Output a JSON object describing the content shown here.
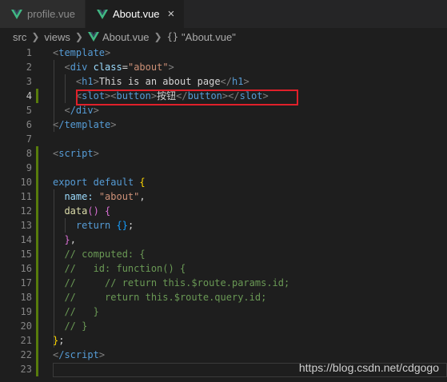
{
  "tabs": [
    {
      "label": "profile.vue",
      "active": false
    },
    {
      "label": "About.vue",
      "active": true,
      "close_glyph": "×"
    }
  ],
  "breadcrumb": {
    "segments": [
      "src",
      "views",
      "About.vue"
    ],
    "symbol": "\"About.vue\"",
    "braces": "{}"
  },
  "lines": [
    {
      "n": "1"
    },
    {
      "n": "2"
    },
    {
      "n": "3"
    },
    {
      "n": "4"
    },
    {
      "n": "5"
    },
    {
      "n": "6"
    },
    {
      "n": "7"
    },
    {
      "n": "8"
    },
    {
      "n": "9"
    },
    {
      "n": "10"
    },
    {
      "n": "11"
    },
    {
      "n": "12"
    },
    {
      "n": "13"
    },
    {
      "n": "14"
    },
    {
      "n": "15"
    },
    {
      "n": "16"
    },
    {
      "n": "17"
    },
    {
      "n": "18"
    },
    {
      "n": "19"
    },
    {
      "n": "20"
    },
    {
      "n": "21"
    },
    {
      "n": "22"
    },
    {
      "n": "23"
    }
  ],
  "code": {
    "l1_tag": "template",
    "l2_tag": "div",
    "l2_attr": "class",
    "l2_val": "\"about\"",
    "l3_tag": "h1",
    "l3_text": "This is an about page",
    "l4_slot": "slot",
    "l4_button": "button",
    "l4_text": "按钮",
    "l5_tag": "/div",
    "l6_tag": "/template",
    "l8_tag": "script",
    "l10_export": "export",
    "l10_default": "default",
    "l11_key": "name:",
    "l11_val": "\"about\"",
    "l12_fn": "data",
    "l13_kw": "return",
    "l15": "// computed: {",
    "l16": "//   id: function() {",
    "l17": "//     // return this.$route.params.id;",
    "l18": "//     return this.$route.query.id;",
    "l19": "//   }",
    "l20": "// }",
    "l22_tag": "/script"
  },
  "watermark": "https://blog.csdn.net/cdgogo",
  "colors": {
    "vue_green": "#41b883",
    "vue_dark": "#35495e",
    "highlight_box": "#e0202a",
    "git_modified_bar": "#587c0c"
  }
}
